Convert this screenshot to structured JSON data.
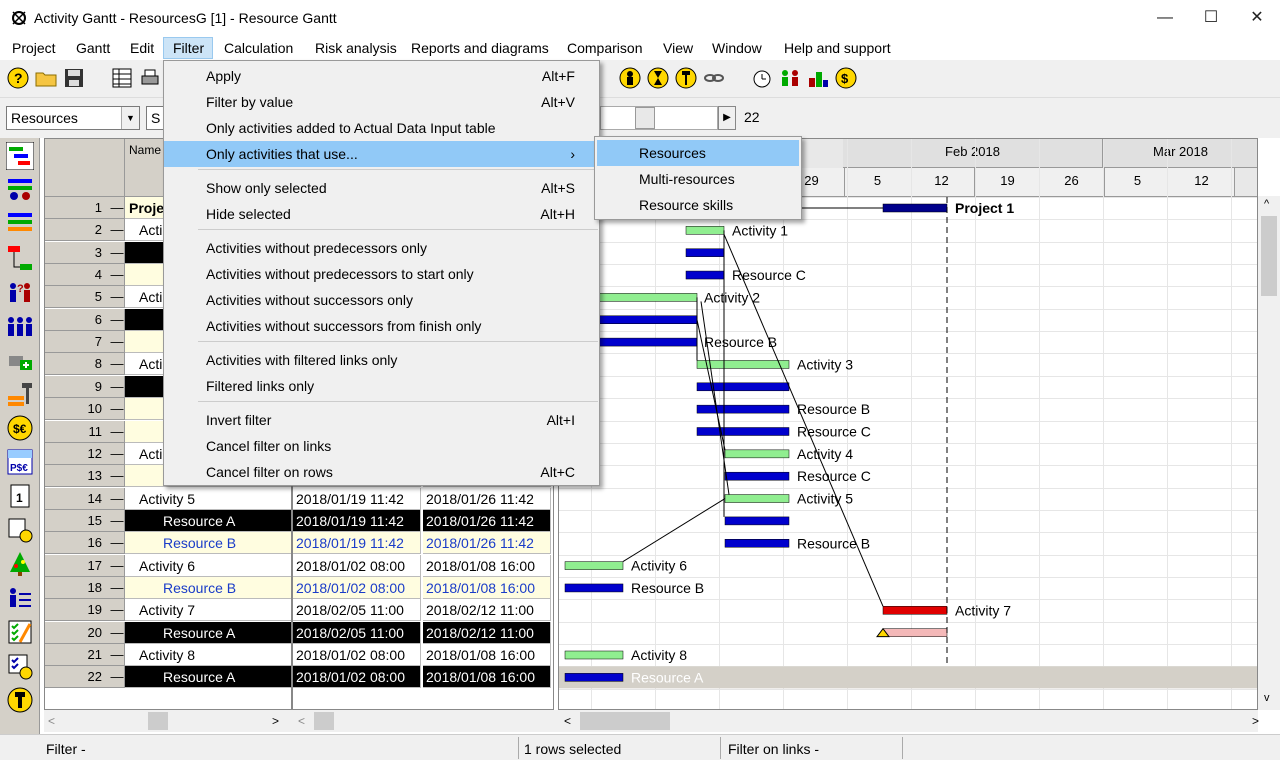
{
  "window": {
    "title": "Activity Gantt - ResourcesG [1] - Resource Gantt"
  },
  "menubar": [
    "Project",
    "Gantt",
    "Edit",
    "Filter",
    "Calculation",
    "Risk analysis",
    "Reports and diagrams",
    "Comparison",
    "View",
    "Window",
    "Help and support"
  ],
  "toolbar2": {
    "view_combo": "Resources",
    "second_combo": "S",
    "zoom_value": "22"
  },
  "filter_menu": {
    "items": [
      {
        "label": "Apply",
        "shortcut": "Alt+F"
      },
      {
        "label": "Filter by value",
        "shortcut": "Alt+V"
      },
      {
        "label": "Only activities added to Actual Data Input table",
        "shortcut": ""
      },
      {
        "label": "Only activities that use...",
        "shortcut": "",
        "submenu": "›"
      },
      {
        "label": "Show only selected",
        "shortcut": "Alt+S"
      },
      {
        "label": "Hide selected",
        "shortcut": "Alt+H"
      },
      {
        "label": "Activities without predecessors only",
        "shortcut": ""
      },
      {
        "label": "Activities without predecessors to start only",
        "shortcut": ""
      },
      {
        "label": "Activities without successors only",
        "shortcut": ""
      },
      {
        "label": "Activities without successors from finish only",
        "shortcut": ""
      },
      {
        "label": "Activities with filtered links only",
        "shortcut": ""
      },
      {
        "label": "Filtered links only",
        "shortcut": ""
      },
      {
        "label": "Invert filter",
        "shortcut": "Alt+I"
      },
      {
        "label": "Cancel filter on links",
        "shortcut": ""
      },
      {
        "label": "Cancel filter on rows",
        "shortcut": "Alt+C"
      }
    ]
  },
  "sub_menu": {
    "items": [
      "Resources",
      "Multi-resources",
      "Resource skills"
    ]
  },
  "grid": {
    "name_header": "Name",
    "rows": [
      {
        "n": "1",
        "name": "Proje",
        "start": "",
        "finish": "",
        "kind": "project"
      },
      {
        "n": "2",
        "name": "Acti",
        "start": "",
        "finish": "",
        "kind": "activity"
      },
      {
        "n": "3",
        "name": "",
        "start": "",
        "finish": "",
        "kind": "resA"
      },
      {
        "n": "4",
        "name": "",
        "start": "",
        "finish": "",
        "kind": "resB"
      },
      {
        "n": "5",
        "name": "Acti",
        "start": "",
        "finish": "",
        "kind": "activity"
      },
      {
        "n": "6",
        "name": "",
        "start": "",
        "finish": "",
        "kind": "resA"
      },
      {
        "n": "7",
        "name": "",
        "start": "",
        "finish": "",
        "kind": "resB"
      },
      {
        "n": "8",
        "name": "Acti",
        "start": "",
        "finish": "",
        "kind": "activity"
      },
      {
        "n": "9",
        "name": "",
        "start": "",
        "finish": "",
        "kind": "resA"
      },
      {
        "n": "10",
        "name": "",
        "start": "",
        "finish": "",
        "kind": "resB"
      },
      {
        "n": "11",
        "name": "",
        "start": "",
        "finish": "",
        "kind": "resB"
      },
      {
        "n": "12",
        "name": "Acti",
        "start": "",
        "finish": "",
        "kind": "activity"
      },
      {
        "n": "13",
        "name": "",
        "start": "",
        "finish": "",
        "kind": "resB"
      },
      {
        "n": "14",
        "name": "Activity 5",
        "start": "2018/01/19  11:42",
        "finish": "2018/01/26  11:42",
        "kind": "activity"
      },
      {
        "n": "15",
        "name": "Resource A",
        "start": "2018/01/19  11:42",
        "finish": "2018/01/26  11:42",
        "kind": "resA"
      },
      {
        "n": "16",
        "name": "Resource B",
        "start": "2018/01/19  11:42",
        "finish": "2018/01/26  11:42",
        "kind": "resB"
      },
      {
        "n": "17",
        "name": "Activity 6",
        "start": "2018/01/02  08:00",
        "finish": "2018/01/08  16:00",
        "kind": "activity"
      },
      {
        "n": "18",
        "name": "Resource B",
        "start": "2018/01/02  08:00",
        "finish": "2018/01/08  16:00",
        "kind": "resB"
      },
      {
        "n": "19",
        "name": "Activity 7",
        "start": "2018/02/05  11:00",
        "finish": "2018/02/12  11:00",
        "kind": "activity"
      },
      {
        "n": "20",
        "name": "Resource A",
        "start": "2018/02/05  11:00",
        "finish": "2018/02/12  11:00",
        "kind": "resA"
      },
      {
        "n": "21",
        "name": "Activity 8",
        "start": "2018/01/02  08:00",
        "finish": "2018/01/08  16:00",
        "kind": "activity"
      },
      {
        "n": "22",
        "name": "Resource A",
        "start": "2018/01/02  08:00",
        "finish": "2018/01/08  16:00",
        "kind": "resA"
      }
    ]
  },
  "gantt": {
    "months": [
      "Feb 2018",
      "Mar 2018"
    ],
    "days": [
      "29",
      "5",
      "12",
      "19",
      "26",
      "5",
      "12"
    ],
    "labels": {
      "project": "Project 1",
      "a1": "Activity 1",
      "rc1": "Resource C",
      "a2": "Activity 2",
      "rb2": "Resource B",
      "a3": "Activity 3",
      "rb3": "Resource B",
      "rc3": "Resource C",
      "a4": "Activity 4",
      "rc4": "Resource C",
      "a5": "Activity 5",
      "rb5": "Resource B",
      "a6": "Activity 6",
      "rb6": "Resource B",
      "a7": "Activity 7",
      "a8": "Activity 8",
      "ra8": "Resource A"
    }
  },
  "status": {
    "seg1": "Filter -",
    "seg2": "1 rows selected",
    "seg3": "Filter on links -"
  },
  "colors": {
    "activity_bar": "#90ee90",
    "resource_bar": "#0000cd",
    "critical_bar": "#e00000",
    "selected_row": "#d4d0c8",
    "resB_bg": "#fffde0",
    "black_cell": "#000000",
    "menu_highlight": "#91c9f7"
  }
}
